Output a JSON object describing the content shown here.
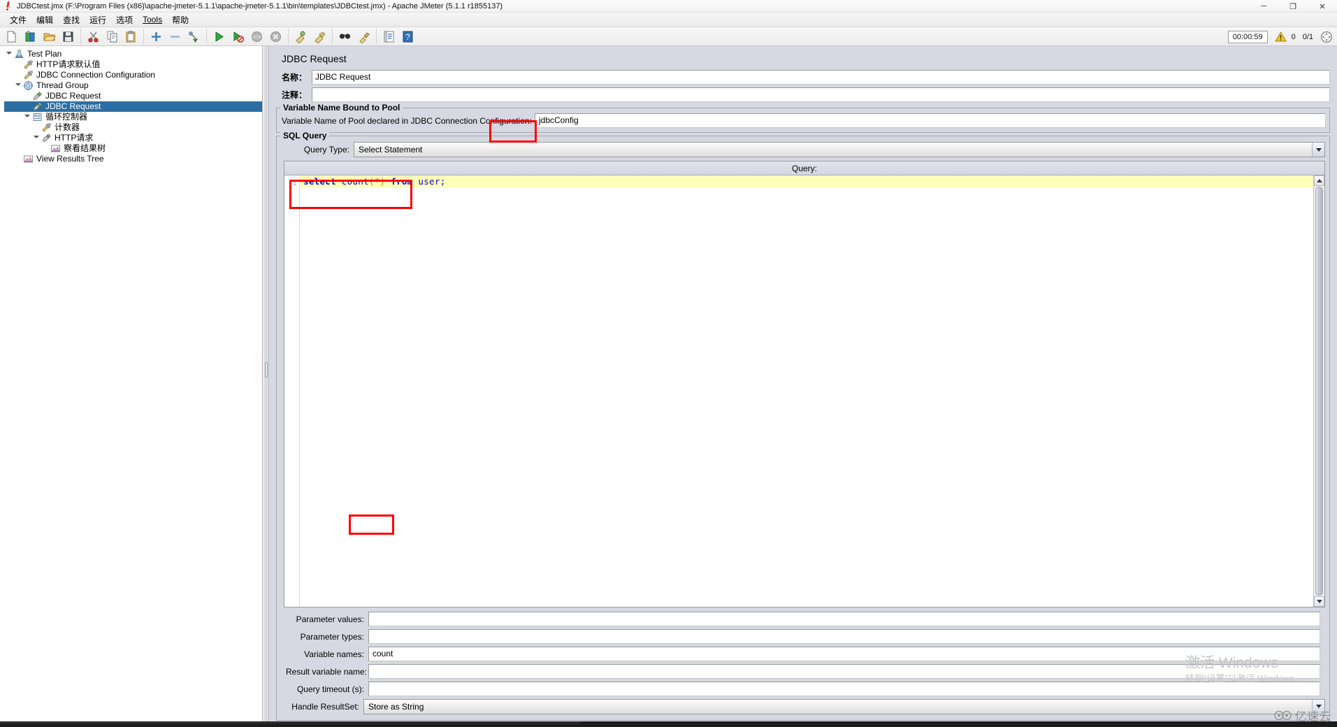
{
  "window": {
    "title": "JDBCtest.jmx (F:\\Program Files (x86)\\apache-jmeter-5.1.1\\apache-jmeter-5.1.1\\bin\\templates\\JDBCtest.jmx) - Apache JMeter (5.1.1 r1855137)",
    "minimize_label": "─",
    "maximize_label": "❐",
    "close_label": "✕",
    "app_icon": "jmeter-flask-icon"
  },
  "menubar": {
    "items": [
      {
        "label": "文件",
        "name": "menu-file"
      },
      {
        "label": "编辑",
        "name": "menu-edit"
      },
      {
        "label": "查找",
        "name": "menu-search"
      },
      {
        "label": "运行",
        "name": "menu-run"
      },
      {
        "label": "选项",
        "name": "menu-options"
      },
      {
        "label": "Tools",
        "name": "menu-tools",
        "mnemonic": "T"
      },
      {
        "label": "帮助",
        "name": "menu-help"
      }
    ]
  },
  "toolbar": {
    "icons": [
      {
        "name": "new-icon",
        "tip": "New"
      },
      {
        "name": "templates-icon",
        "tip": "Templates"
      },
      {
        "name": "open-icon",
        "tip": "Open"
      },
      {
        "name": "save-icon",
        "tip": "Save Test Plan"
      },
      {
        "name": "cut-icon",
        "tip": "Cut"
      },
      {
        "name": "copy-icon",
        "tip": "Copy"
      },
      {
        "name": "paste-icon",
        "tip": "Paste"
      },
      {
        "name": "expand-all-icon",
        "tip": "Expand All"
      },
      {
        "name": "collapse-all-icon",
        "tip": "Collapse All"
      },
      {
        "name": "toggle-icon",
        "tip": "Toggle"
      },
      {
        "name": "start-icon",
        "tip": "Start"
      },
      {
        "name": "start-no-timers-icon",
        "tip": "Start no pauses"
      },
      {
        "name": "stop-icon",
        "tip": "Stop"
      },
      {
        "name": "shutdown-icon",
        "tip": "Shutdown"
      },
      {
        "name": "clear-icon",
        "tip": "Clear"
      },
      {
        "name": "clear-all-icon",
        "tip": "Clear All"
      },
      {
        "name": "search-icon",
        "tip": "Search"
      },
      {
        "name": "reset-search-icon",
        "tip": "Reset Search"
      },
      {
        "name": "function-helper-icon",
        "tip": "Function Helper Dialog"
      },
      {
        "name": "help-icon",
        "tip": "Help"
      }
    ],
    "status": {
      "timer": "00:00:59",
      "warning_icon": "warning-triangle-icon",
      "warning_count": "0",
      "threads": "0/1",
      "remote_icon": "remote-engines-icon"
    }
  },
  "tree": {
    "nodes": [
      {
        "label": "Test Plan",
        "depth": 0,
        "twisty": "open",
        "icon": "test-plan-icon",
        "selected": false,
        "name": "tree-node-test-plan"
      },
      {
        "label": "HTTP请求默认值",
        "depth": 1,
        "twisty": "none",
        "icon": "config-element-icon",
        "selected": false,
        "name": "tree-node-http-request-defaults"
      },
      {
        "label": "JDBC Connection Configuration",
        "depth": 1,
        "twisty": "none",
        "icon": "config-element-icon",
        "selected": false,
        "name": "tree-node-jdbc-connection-configuration"
      },
      {
        "label": "Thread Group",
        "depth": 1,
        "twisty": "open",
        "icon": "thread-group-icon",
        "selected": false,
        "name": "tree-node-thread-group"
      },
      {
        "label": "JDBC Request",
        "depth": 2,
        "twisty": "none",
        "icon": "sampler-icon",
        "selected": false,
        "name": "tree-node-jdbc-request-1"
      },
      {
        "label": "JDBC Request",
        "depth": 2,
        "twisty": "none",
        "icon": "sampler-icon",
        "selected": true,
        "name": "tree-node-jdbc-request-2"
      },
      {
        "label": "循环控制器",
        "depth": 2,
        "twisty": "open",
        "icon": "controller-icon",
        "selected": false,
        "name": "tree-node-loop-controller"
      },
      {
        "label": "计数器",
        "depth": 3,
        "twisty": "none",
        "icon": "config-element-icon",
        "selected": false,
        "name": "tree-node-counter"
      },
      {
        "label": "HTTP请求",
        "depth": 3,
        "twisty": "open",
        "icon": "sampler-icon",
        "selected": false,
        "name": "tree-node-http-request"
      },
      {
        "label": "察看结果树",
        "depth": 4,
        "twisty": "none",
        "icon": "listener-icon",
        "selected": false,
        "name": "tree-node-view-results-tree-cn"
      },
      {
        "label": "View Results Tree",
        "depth": 1,
        "twisty": "none",
        "icon": "listener-icon",
        "selected": false,
        "name": "tree-node-view-results-tree"
      }
    ]
  },
  "panel": {
    "title": "JDBC Request",
    "name_label": "名称：",
    "name_value": "JDBC Request",
    "comment_label": "注释：",
    "comment_value": "",
    "pool_group_title": "Variable Name Bound to Pool",
    "pool_field_label": "Variable Name of Pool declared in JDBC Connection Configuration:",
    "pool_field_value": "jdbcConfig",
    "sql_group_title": "SQL Query",
    "query_type_label": "Query Type:",
    "query_type_value": "Select Statement",
    "query_header": "Query:",
    "query_line_number": "1",
    "query_tokens": [
      {
        "text": "select",
        "cls": "kw"
      },
      {
        "text": " ",
        "cls": "plain"
      },
      {
        "text": "count",
        "cls": "fn"
      },
      {
        "text": "(",
        "cls": "pn"
      },
      {
        "text": "*",
        "cls": "st"
      },
      {
        "text": ")",
        "cls": "pn"
      },
      {
        "text": " ",
        "cls": "plain"
      },
      {
        "text": "from",
        "cls": "kw"
      },
      {
        "text": " ",
        "cls": "plain"
      },
      {
        "text": "user;",
        "cls": "id"
      }
    ],
    "query_text": "select count(*) from user;",
    "fields": [
      {
        "label": "Parameter values:",
        "value": "",
        "name": "parameter-values-field"
      },
      {
        "label": "Parameter types:",
        "value": "",
        "name": "parameter-types-field"
      },
      {
        "label": "Variable names:",
        "value": "count",
        "name": "variable-names-field"
      },
      {
        "label": "Result variable name:",
        "value": "",
        "name": "result-variable-name-field"
      },
      {
        "label": "Query timeout (s):",
        "value": "",
        "name": "query-timeout-field"
      }
    ],
    "handle_resultset_label": "Handle ResultSet:",
    "handle_resultset_value": "Store as String"
  },
  "watermark": {
    "line1": "激活 Windows",
    "line2": "转到“设置”以激活 Windows。"
  },
  "logo": {
    "text": "亿速云"
  },
  "colors": {
    "selection": "#2c6ea3",
    "highlight_box": "#ff0000",
    "panel_bg": "#d6d9e2",
    "code_line_bg": "#ffffba"
  }
}
